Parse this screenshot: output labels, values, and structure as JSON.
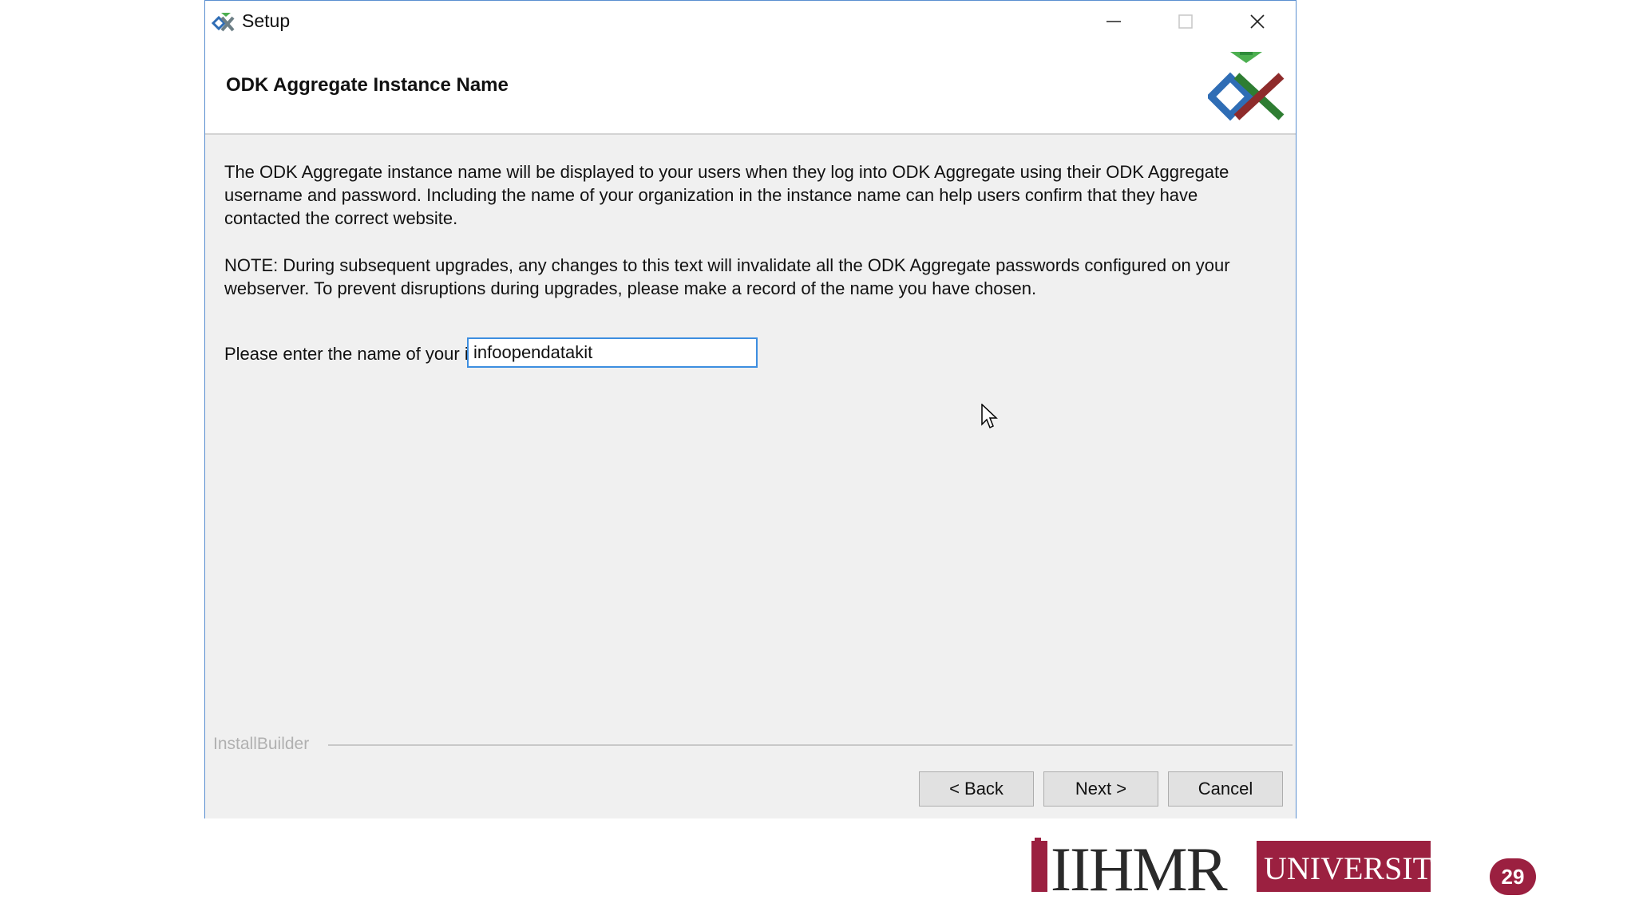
{
  "window": {
    "title": "Setup",
    "controls": {
      "minimize": "minimize",
      "maximize": "maximize",
      "close": "close"
    }
  },
  "header": {
    "title": "ODK Aggregate Instance Name"
  },
  "content": {
    "paragraph1": "The ODK Aggregate instance name will be displayed to your users when they log into ODK Aggregate using their ODK Aggregate username and password. Including the name of your organization in the instance name can help users confirm that they have contacted the correct website.",
    "paragraph2": "NOTE: During subsequent upgrades, any changes to this text will invalidate all the ODK Aggregate passwords configured on your webserver.  To prevent disruptions during upgrades, please make a record of the name you have chosen.",
    "field_label": "Please enter the name of your instance:",
    "field_value": "infoopendatakit"
  },
  "footer": {
    "brand": "InstallBuilder",
    "back_label": "< Back",
    "next_label": "Next >",
    "cancel_label": "Cancel"
  },
  "slide": {
    "logo_text_left": "IIHMR",
    "logo_text_right": "UNIVERSITY",
    "page_number": "29"
  },
  "colors": {
    "accent_border": "#3d8ee0",
    "logo_maroon": "#9b2040"
  }
}
